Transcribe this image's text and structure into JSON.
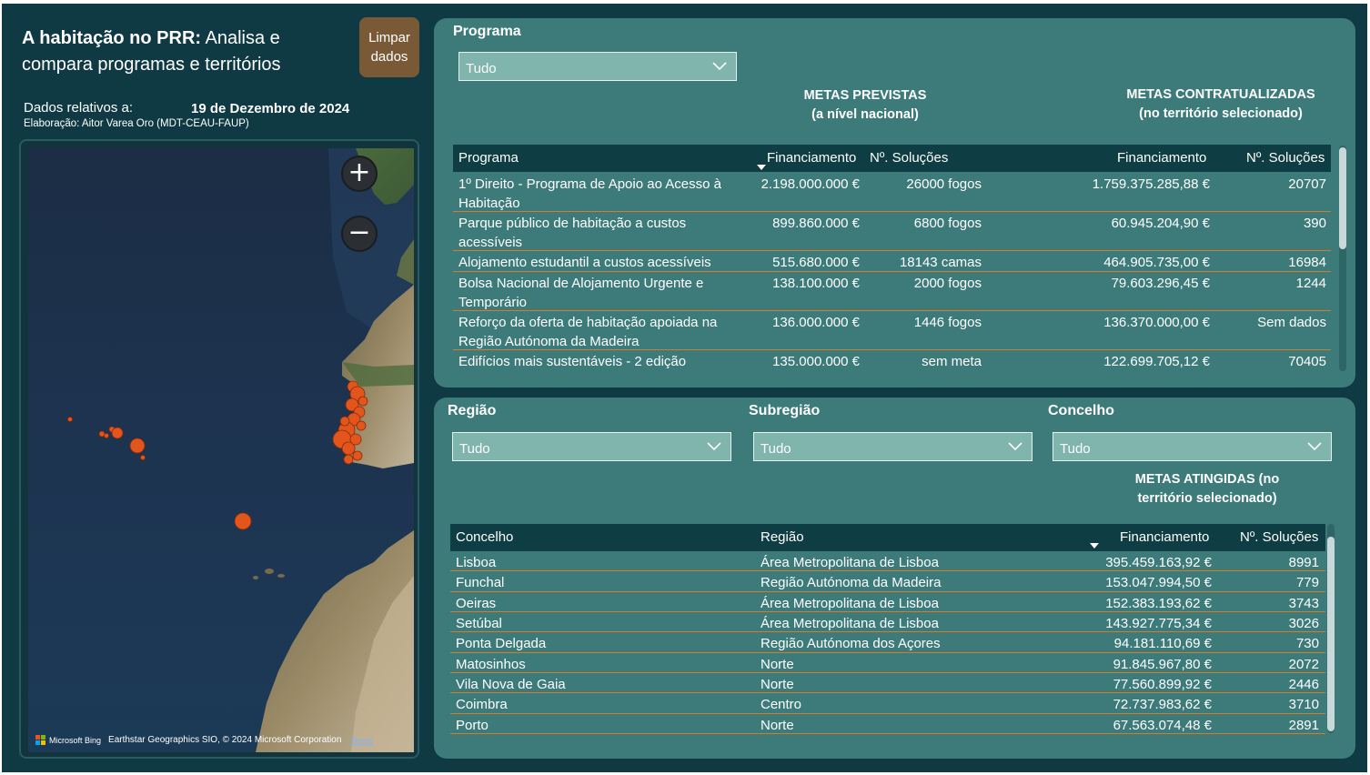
{
  "header": {
    "title_bold": "A habitação no PRR:",
    "title_rest": " Analisa e compara programas e territórios",
    "clear_button_line1": "Limpar",
    "clear_button_line2": "dados",
    "dados_label": "Dados relativos a:",
    "dados_date": "19 de Dezembro de 2024",
    "elaboracao": "Elaboração: Aitor Varea Oro (MDT-CEAU-FAUP)"
  },
  "map": {
    "zoom_in": "+",
    "zoom_out": "−",
    "bing_label": "Microsoft Bing",
    "attribution": "Earthstar Geographics SIO, © 2024 Microsoft Corporation",
    "terms": "Terms",
    "colors": {
      "ocean": "#1c3550",
      "land": "#8a7d5e",
      "marker": "#e2561d"
    }
  },
  "programa_panel": {
    "slicer_title": "Programa",
    "slicer_value": "Tudo",
    "metas_previstas_line1": "METAS PREVISTAS",
    "metas_previstas_line2": "(a nível nacional)",
    "metas_contratualizadas_line1": "METAS CONTRATUALIZADAS",
    "metas_contratualizadas_line2": "(no território selecionado)",
    "columns": [
      "Programa",
      "Financiamento",
      "Nº. Soluções",
      "Financiamento",
      "Nº. Soluções"
    ],
    "rows": [
      {
        "programa_l1": "1º Direito - Programa de Apoio ao Acesso à",
        "programa_l2": "Habitação",
        "fin_prev": "2.198.000.000 €",
        "sol_prev": "26000 fogos",
        "fin_contr": "1.759.375.285,88 €",
        "sol_contr": "20707"
      },
      {
        "programa_l1": "Parque público de habitação a custos",
        "programa_l2": "acessíveis",
        "fin_prev": "899.860.000 €",
        "sol_prev": "6800 fogos",
        "fin_contr": "60.945.204,90 €",
        "sol_contr": "390"
      },
      {
        "programa_l1": "Alojamento estudantil a custos acessíveis",
        "programa_l2": "",
        "fin_prev": "515.680.000 €",
        "sol_prev": "18143 camas",
        "fin_contr": "464.905.735,00 €",
        "sol_contr": "16984"
      },
      {
        "programa_l1": "Bolsa Nacional de Alojamento Urgente e",
        "programa_l2": "Temporário",
        "fin_prev": "138.100.000 €",
        "sol_prev": "2000 fogos",
        "fin_contr": "79.603.296,45 €",
        "sol_contr": "1244"
      },
      {
        "programa_l1": "Reforço da oferta de habitação apoiada na",
        "programa_l2": "Região Autónoma da Madeira",
        "fin_prev": "136.000.000 €",
        "sol_prev": "1446 fogos",
        "fin_contr": "136.370.000,00 €",
        "sol_contr": "Sem dados"
      },
      {
        "programa_l1": "Edifícios mais sustentáveis - 2 edição",
        "programa_l2": "",
        "fin_prev": "135.000.000 €",
        "sol_prev": "sem meta",
        "fin_contr": "122.699.705,12 €",
        "sol_contr": "70405"
      }
    ]
  },
  "territorio_panel": {
    "regiao_title": "Região",
    "regiao_value": "Tudo",
    "subregiao_title": "Subregião",
    "subregiao_value": "Tudo",
    "concelho_title": "Concelho",
    "concelho_value": "Tudo",
    "metas_atingidas_line1": "METAS ATINGIDAS (no",
    "metas_atingidas_line2": "território selecionado)",
    "columns": [
      "Concelho",
      "Região",
      "Financiamento",
      "Nº. Soluções"
    ],
    "rows": [
      {
        "concelho": "Lisboa",
        "regiao": "Área Metropolitana de Lisboa",
        "fin": "395.459.163,92 €",
        "sol": "8991"
      },
      {
        "concelho": "Funchal",
        "regiao": "Região Autónoma da Madeira",
        "fin": "153.047.994,50 €",
        "sol": "779"
      },
      {
        "concelho": "Oeiras",
        "regiao": "Área Metropolitana de Lisboa",
        "fin": "152.383.193,62 €",
        "sol": "3743"
      },
      {
        "concelho": "Setúbal",
        "regiao": "Área Metropolitana de Lisboa",
        "fin": "143.927.775,34 €",
        "sol": "3026"
      },
      {
        "concelho": "Ponta Delgada",
        "regiao": "Região Autónoma dos Açores",
        "fin": "94.181.110,69 €",
        "sol": "730"
      },
      {
        "concelho": "Matosinhos",
        "regiao": "Norte",
        "fin": "91.845.967,80 €",
        "sol": "2072"
      },
      {
        "concelho": "Vila Nova de Gaia",
        "regiao": "Norte",
        "fin": "77.560.899,92 €",
        "sol": "2446"
      },
      {
        "concelho": "Coimbra",
        "regiao": "Centro",
        "fin": "72.737.983,62 €",
        "sol": "3710"
      },
      {
        "concelho": "Porto",
        "regiao": "Norte",
        "fin": "67.563.074,48 €",
        "sol": "2891"
      }
    ]
  }
}
